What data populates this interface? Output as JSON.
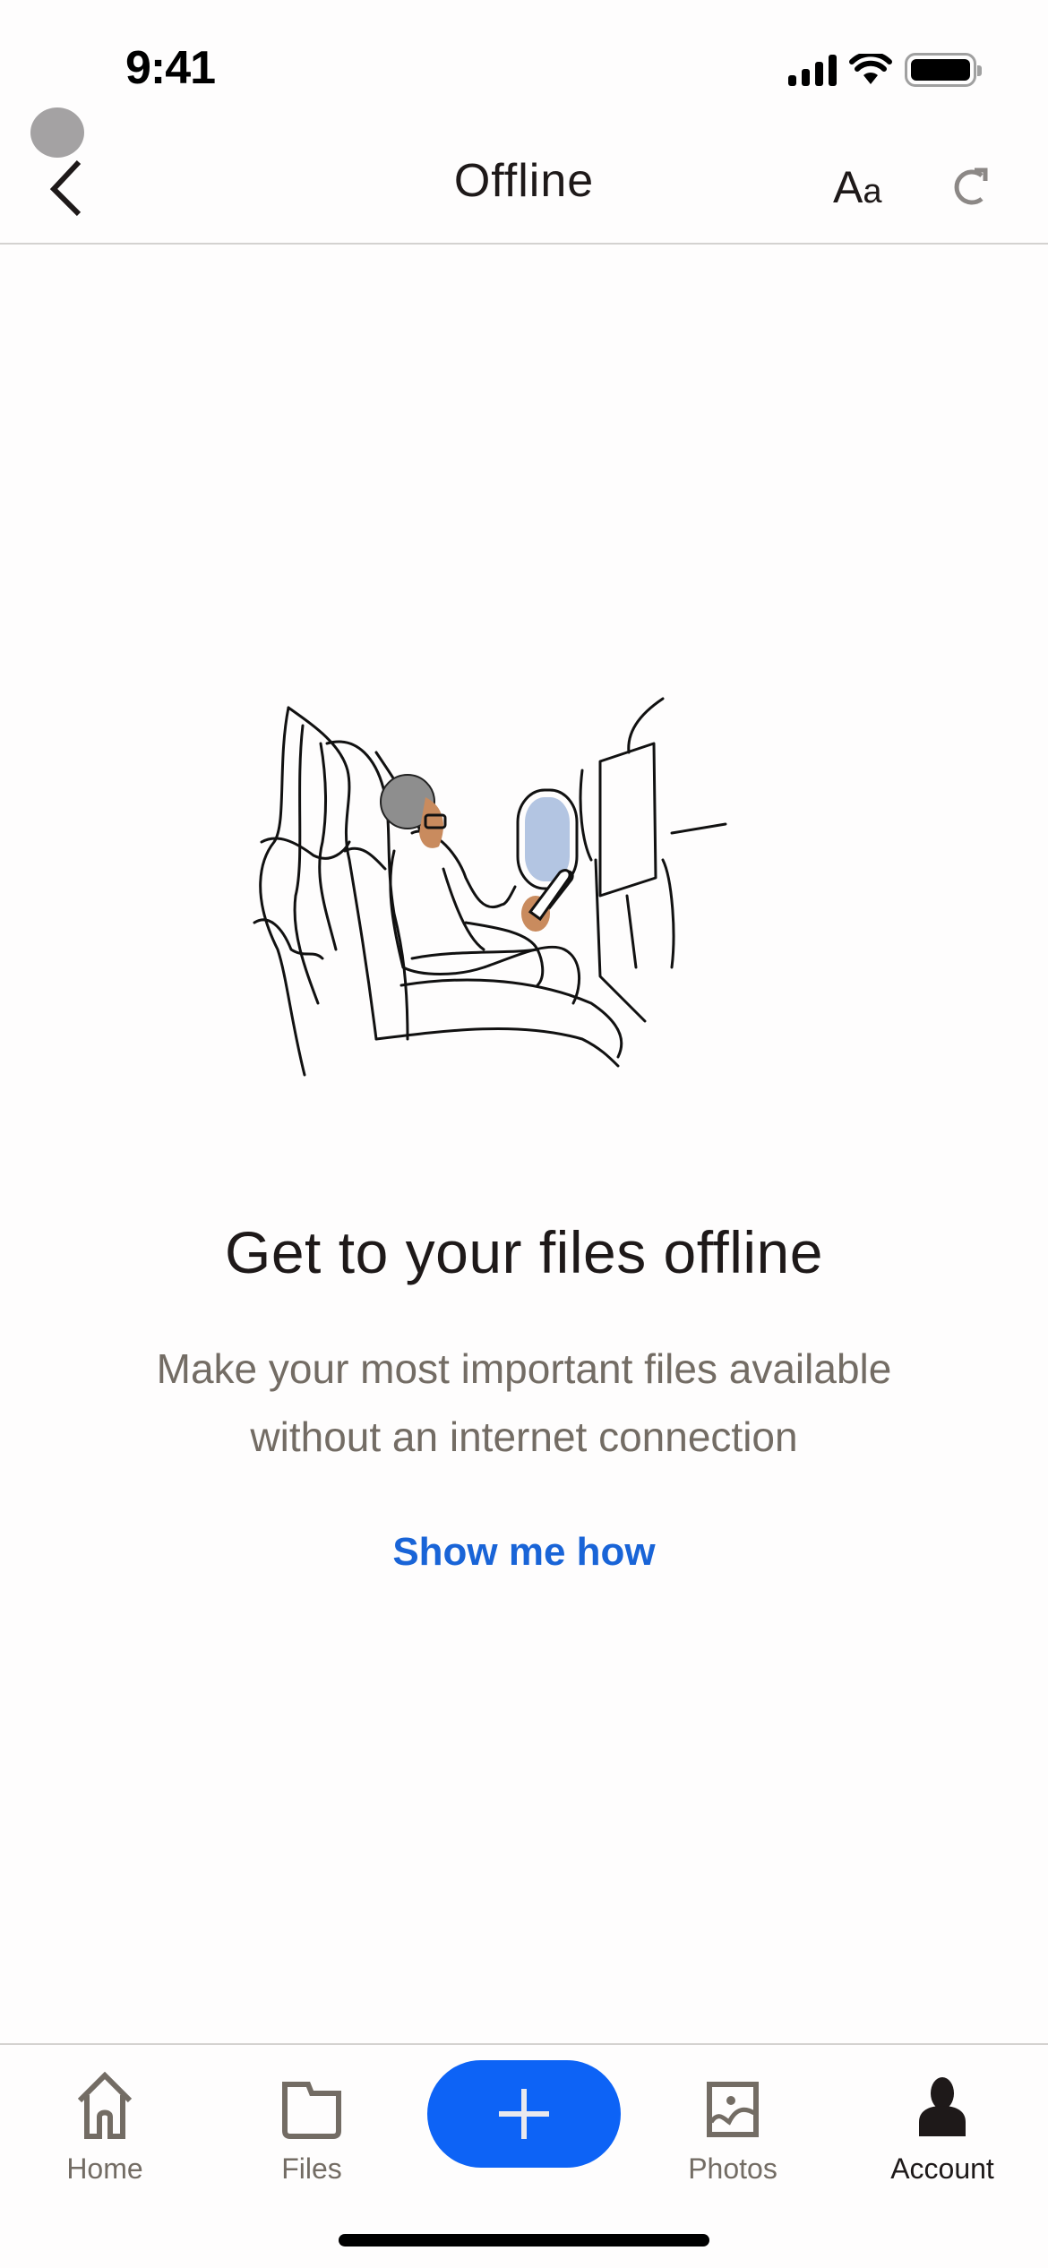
{
  "status_bar": {
    "time": "9:41",
    "icons": [
      "cellular-signal-icon",
      "wifi-icon",
      "battery-icon"
    ]
  },
  "nav": {
    "title": "Offline",
    "back_icon": "chevron-left-icon",
    "text_size_label_big": "A",
    "text_size_label_small": "a",
    "refresh_icon": "refresh-icon"
  },
  "empty_state": {
    "illustration": "person-on-airplane-reading-tablet",
    "headline": "Get to your files offline",
    "subtext_line1": "Make your most important files available",
    "subtext_line2": "without an internet connection",
    "link_label": "Show me how"
  },
  "tab_bar": {
    "items": [
      {
        "label": "Home",
        "icon": "home-icon",
        "active": false
      },
      {
        "label": "Files",
        "icon": "folder-icon",
        "active": false
      },
      {
        "label": "Photos",
        "icon": "photo-icon",
        "active": false
      },
      {
        "label": "Account",
        "icon": "person-icon",
        "active": true
      }
    ],
    "fab_icon": "plus-icon"
  },
  "colors": {
    "accent": "#0d63f6",
    "link": "#1964d7",
    "text_primary": "#1e1919",
    "text_secondary": "#736c64",
    "window_sky": "#b3c5e2",
    "skin": "#c98b5e",
    "hair": "#8e8e8e"
  }
}
